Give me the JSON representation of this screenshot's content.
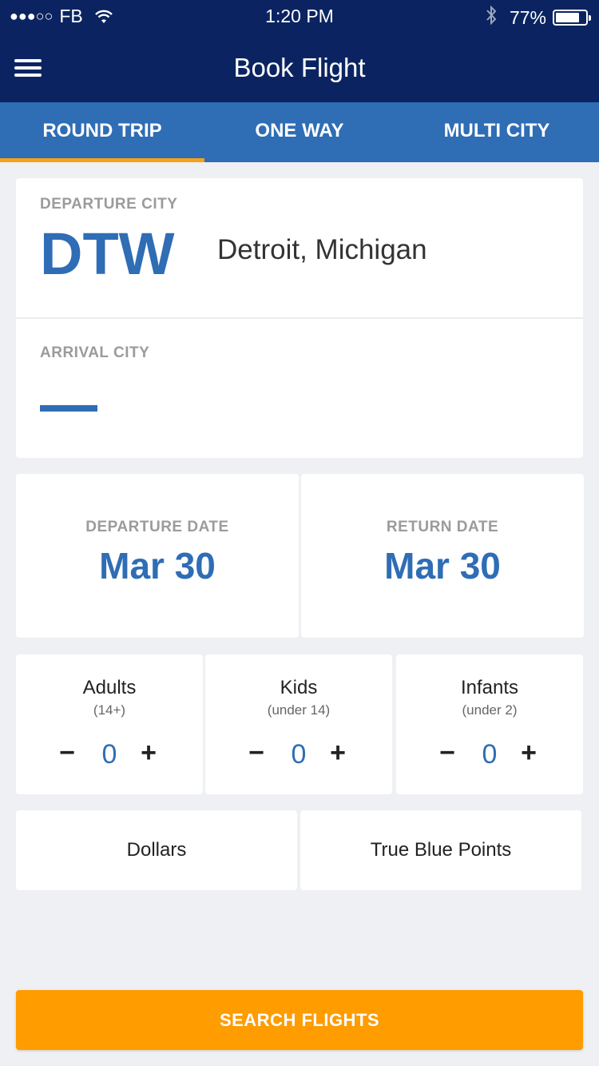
{
  "status_bar": {
    "signal": "●●●○○",
    "carrier": "FB",
    "wifi_icon": "wifi-icon",
    "time": "1:20 PM",
    "bluetooth_icon": "bluetooth-icon",
    "battery_percent": "77%",
    "battery_level": 0.77
  },
  "navbar": {
    "menu_icon": "hamburger-menu-icon",
    "title": "Book Flight"
  },
  "tabs": [
    {
      "label": "ROUND TRIP",
      "active": true
    },
    {
      "label": "ONE WAY",
      "active": false
    },
    {
      "label": "MULTI CITY",
      "active": false
    }
  ],
  "departure": {
    "label": "DEPARTURE CITY",
    "code": "DTW",
    "city": "Detroit, Michigan"
  },
  "arrival": {
    "label": "ARRIVAL CITY",
    "code": ""
  },
  "dates": {
    "departure_label": "DEPARTURE DATE",
    "departure_value": "Mar 30",
    "return_label": "RETURN DATE",
    "return_value": "Mar 30"
  },
  "passengers": [
    {
      "title": "Adults",
      "sub": "(14+)",
      "count": "0",
      "minus": "−",
      "plus": "+"
    },
    {
      "title": "Kids",
      "sub": "(under 14)",
      "count": "0",
      "minus": "−",
      "plus": "+"
    },
    {
      "title": "Infants",
      "sub": "(under 2)",
      "count": "0",
      "minus": "−",
      "plus": "+"
    }
  ],
  "payment": {
    "option1": "Dollars",
    "option2": "True Blue Points"
  },
  "search_button": "SEARCH FLIGHTS",
  "colors": {
    "navy": "#0b2461",
    "blue": "#2f6db5",
    "accent_orange": "#ff9c00",
    "tab_indicator": "#f7a11a"
  }
}
